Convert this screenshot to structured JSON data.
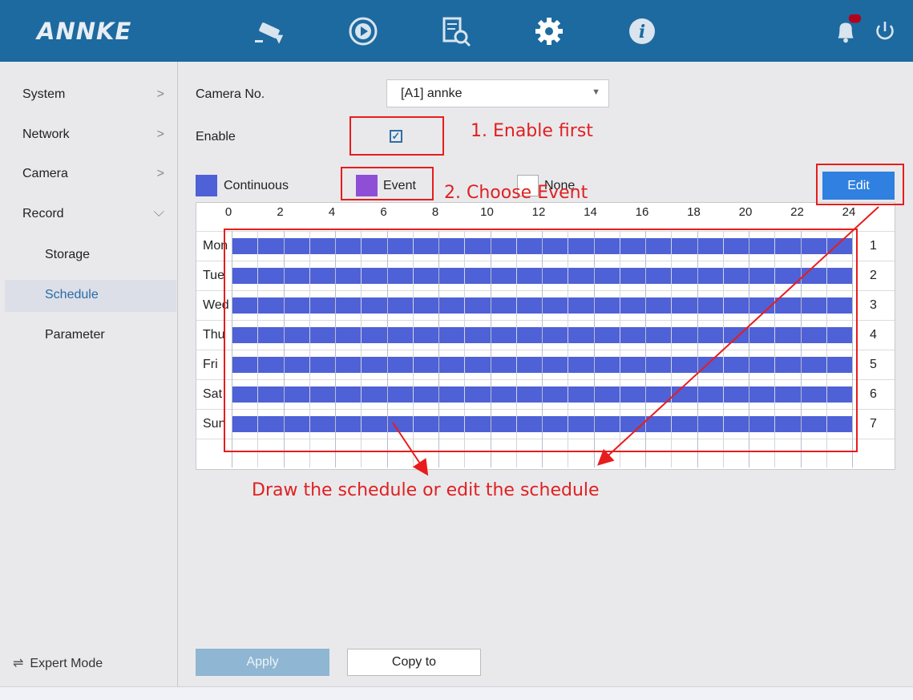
{
  "brand": "ANNKE",
  "header": {
    "icons": [
      "camera-icon",
      "playback-icon",
      "search-file-icon",
      "gear-icon",
      "info-icon",
      "bell-icon",
      "power-icon"
    ]
  },
  "sidebar": {
    "items": [
      {
        "label": "System",
        "chevron": ">"
      },
      {
        "label": "Network",
        "chevron": ">"
      },
      {
        "label": "Camera",
        "chevron": ">"
      },
      {
        "label": "Record",
        "chevron": "⌵"
      }
    ],
    "sub_items": [
      {
        "label": "Storage"
      },
      {
        "label": "Schedule"
      },
      {
        "label": "Parameter"
      }
    ],
    "expert_mode": "Expert Mode"
  },
  "form": {
    "camera_label": "Camera No.",
    "camera_value": "[A1] annke",
    "enable_label": "Enable",
    "enable_checked": true
  },
  "legend": {
    "continuous": "Continuous",
    "event": "Event",
    "none": "None",
    "continuous_color": "#4f61d6",
    "event_color": "#8e4fd6"
  },
  "buttons": {
    "edit": "Edit",
    "apply": "Apply",
    "copy_to": "Copy to"
  },
  "schedule": {
    "hours": [
      "0",
      "2",
      "4",
      "6",
      "8",
      "10",
      "12",
      "14",
      "16",
      "18",
      "20",
      "22",
      "24"
    ],
    "days": [
      {
        "label": "Mon",
        "num": "1"
      },
      {
        "label": "Tue",
        "num": "2"
      },
      {
        "label": "Wed",
        "num": "3"
      },
      {
        "label": "Thu",
        "num": "4"
      },
      {
        "label": "Fri",
        "num": "5"
      },
      {
        "label": "Sat",
        "num": "6"
      },
      {
        "label": "Sun",
        "num": "7"
      }
    ]
  },
  "annotations": {
    "step1": "1. Enable first",
    "step2": "2. Choose Event",
    "step3": "Draw the schedule or edit the schedule"
  }
}
